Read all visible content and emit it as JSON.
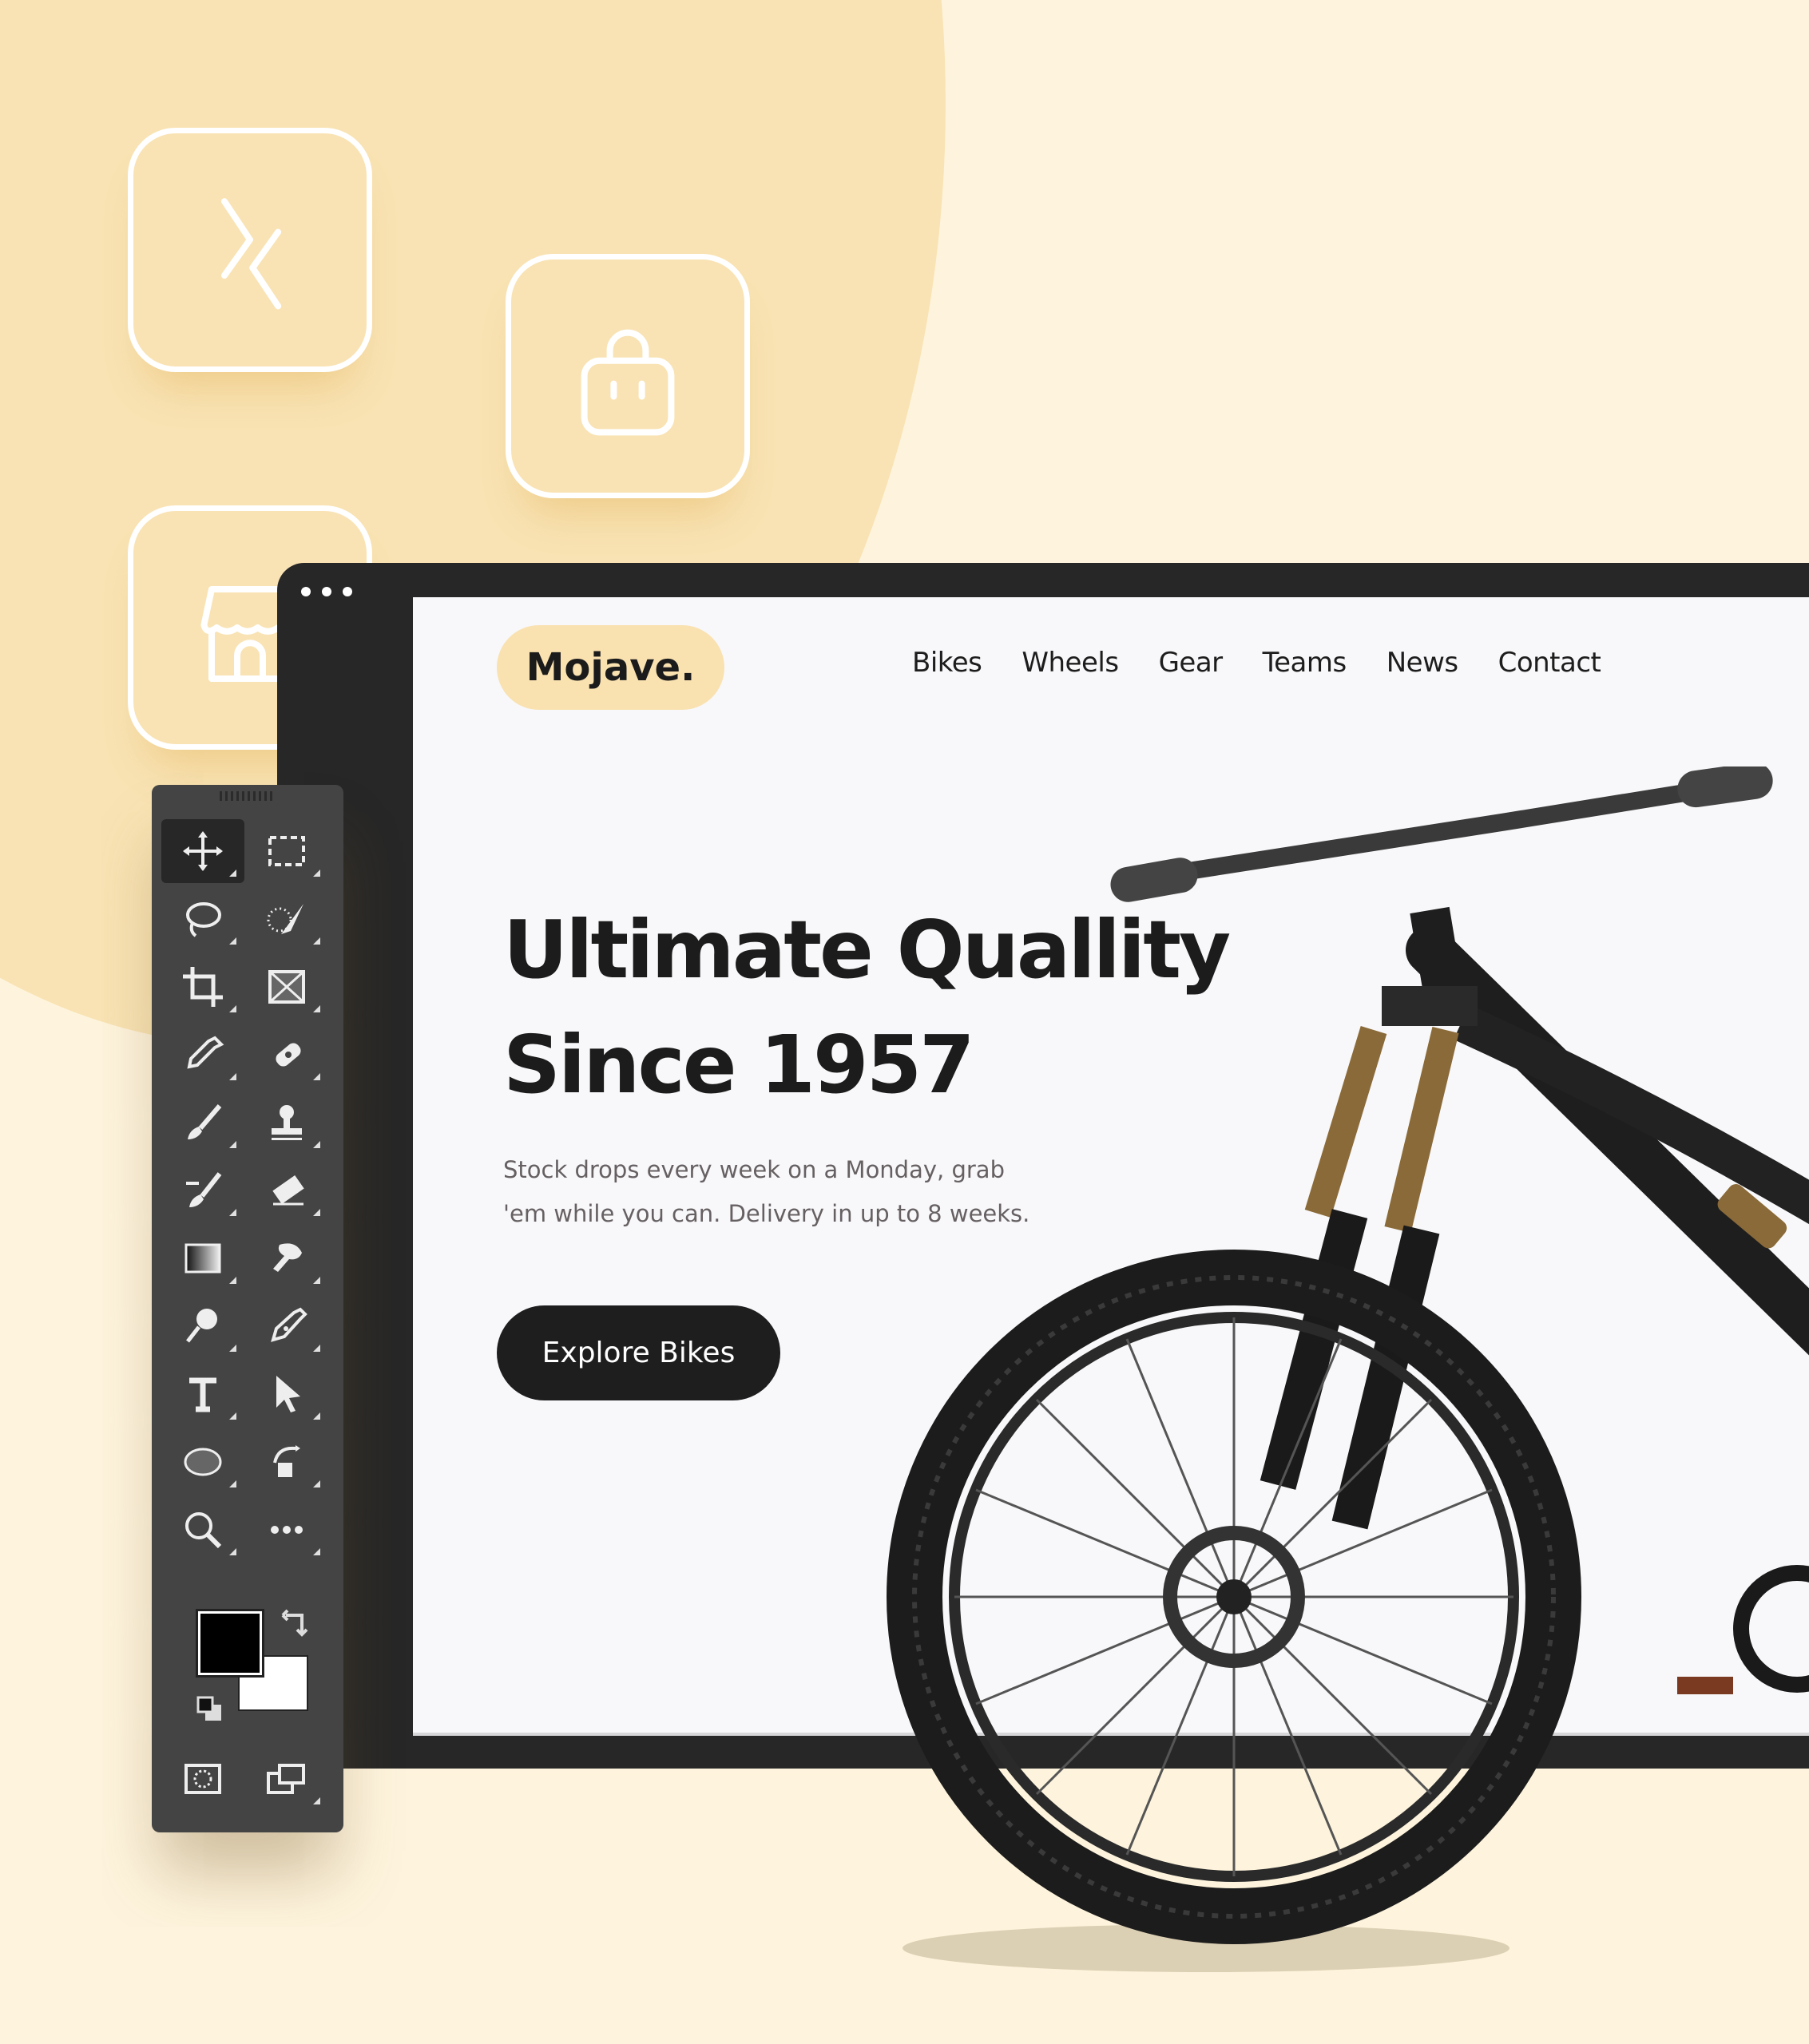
{
  "colors": {
    "background": "#FEF4DD",
    "circle": "#F9E3B4",
    "monitor_frame": "#272727",
    "screen": "#F8F8FA",
    "logo_pill": "#F9E1B0",
    "cta": "#1F1E1F",
    "toolbar": "#444444"
  },
  "app_icons": [
    {
      "name": "xcode-icon"
    },
    {
      "name": "lock-icon"
    },
    {
      "name": "storefront-icon"
    }
  ],
  "website": {
    "logo": "Mojave.",
    "nav": [
      "Bikes",
      "Wheels",
      "Gear",
      "Teams",
      "News",
      "Contact"
    ],
    "hero_title_line1": "Ultimate Quallity",
    "hero_title_line2": "Since 1957",
    "hero_subtitle_line1": "Stock drops every week on a Monday, grab",
    "hero_subtitle_line2": "'em while you can. Delivery in up to 8 weeks.",
    "cta_label": "Explore Bikes"
  },
  "toolbar": {
    "tools": [
      {
        "name": "move-tool",
        "active": true
      },
      {
        "name": "marquee-tool"
      },
      {
        "name": "lasso-tool"
      },
      {
        "name": "quick-selection-tool"
      },
      {
        "name": "crop-tool"
      },
      {
        "name": "frame-tool"
      },
      {
        "name": "eyedropper-tool"
      },
      {
        "name": "healing-brush-tool"
      },
      {
        "name": "brush-tool"
      },
      {
        "name": "clone-stamp-tool"
      },
      {
        "name": "history-brush-tool"
      },
      {
        "name": "eraser-tool"
      },
      {
        "name": "gradient-tool"
      },
      {
        "name": "smudge-tool"
      },
      {
        "name": "dodge-tool"
      },
      {
        "name": "pen-tool"
      },
      {
        "name": "type-tool"
      },
      {
        "name": "path-selection-tool"
      },
      {
        "name": "ellipse-tool"
      },
      {
        "name": "rotate-view-tool"
      },
      {
        "name": "zoom-tool"
      },
      {
        "name": "more-tools"
      },
      {
        "name": "quick-mask-mode"
      },
      {
        "name": "screen-mode"
      }
    ],
    "foreground_color": "#000000",
    "background_color": "#FFFFFF"
  }
}
